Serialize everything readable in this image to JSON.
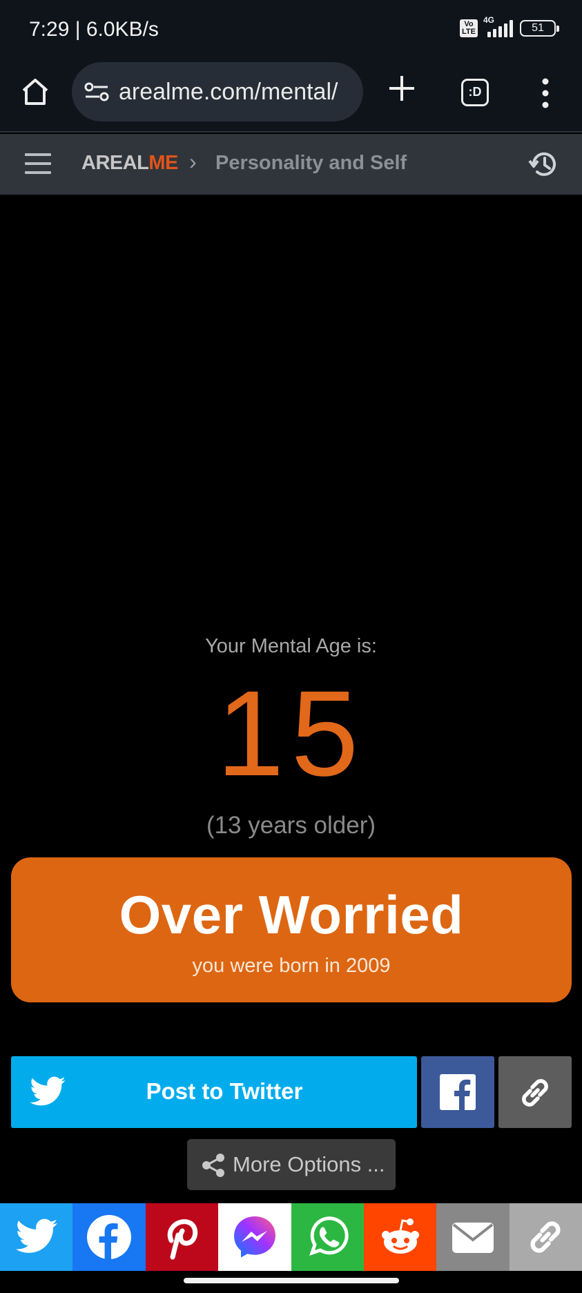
{
  "status_bar": {
    "time_speed": "7:29 | 6.0KB/s",
    "volte": "Vo\nLTE",
    "network": "4G",
    "battery": "51"
  },
  "browser": {
    "url": "arealme.com/mental/",
    "tabs_label": ":D",
    "icons": [
      "home-icon",
      "site-settings-icon",
      "new-tab-icon",
      "tab-switcher-icon",
      "more-menu-icon"
    ]
  },
  "site_header": {
    "logo_part1": "AREAL",
    "logo_part2": "ME",
    "breadcrumb_separator": "›",
    "breadcrumb": "Personality and Self",
    "icons": [
      "menu-icon",
      "history-icon"
    ]
  },
  "result": {
    "label": "Your Mental Age is:",
    "age": "15",
    "difference": "(13 years older)",
    "verdict": "Over Worried",
    "verdict_sub": "you were born in 2009"
  },
  "share": {
    "twitter_label": "Post to Twitter",
    "more_options_label": "More Options ..."
  },
  "share_bar": {
    "services": [
      "twitter",
      "facebook",
      "pinterest",
      "messenger",
      "whatsapp",
      "reddit",
      "email",
      "copy-link"
    ]
  },
  "colors": {
    "accent_orange": "#dd6613",
    "age_orange": "#e2681a",
    "logo_red": "#e1541a",
    "twitter": "#02acec",
    "facebook": "#3c5a99",
    "link_gray": "#5d5d5d",
    "bar_twitter": "#1da1f2",
    "bar_facebook": "#1877f2",
    "bar_pinterest": "#bd081c",
    "bar_messenger": "#ffffff",
    "bar_whatsapp": "#2cb742",
    "bar_reddit": "#ff4500",
    "bar_email": "#888888",
    "bar_copy": "#aaaaaa"
  }
}
